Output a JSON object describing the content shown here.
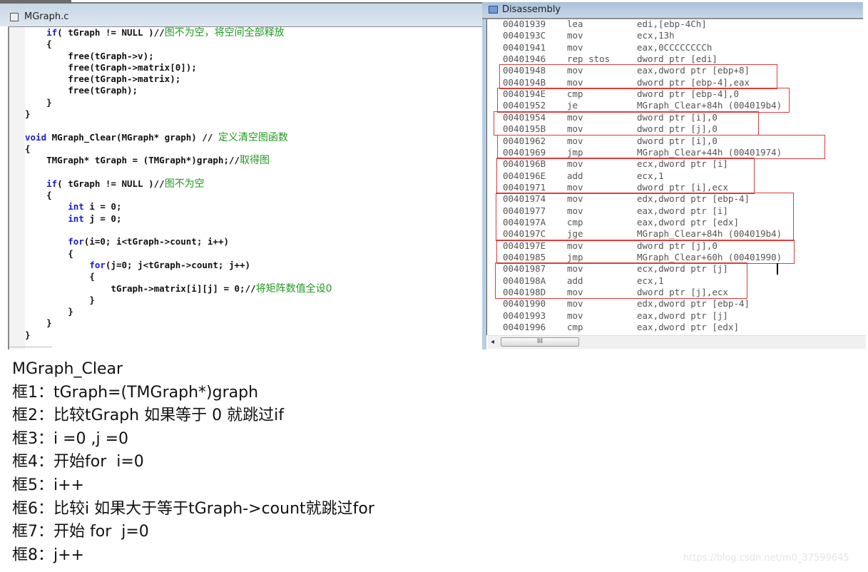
{
  "code_window": {
    "title": "MGraph.c",
    "lines": [
      {
        "indent": "    ",
        "kw": "if",
        "code": "( tGraph != NULL )//",
        "comment": "图不为空，将空间全部释放"
      },
      {
        "indent": "    ",
        "kw": "",
        "code": "{",
        "comment": ""
      },
      {
        "indent": "        ",
        "kw": "",
        "code": "free(tGraph->v);",
        "comment": ""
      },
      {
        "indent": "        ",
        "kw": "",
        "code": "free(tGraph->matrix[0]);",
        "comment": ""
      },
      {
        "indent": "        ",
        "kw": "",
        "code": "free(tGraph->matrix);",
        "comment": ""
      },
      {
        "indent": "        ",
        "kw": "",
        "code": "free(tGraph);",
        "comment": ""
      },
      {
        "indent": "    ",
        "kw": "",
        "code": "}",
        "comment": ""
      },
      {
        "indent": "",
        "kw": "",
        "code": "}",
        "comment": ""
      },
      {
        "indent": "",
        "kw": "",
        "code": "",
        "comment": ""
      },
      {
        "indent": "",
        "kw": "void",
        "code": " MGraph_Clear(MGraph* graph) // ",
        "comment": "定义清空图函数"
      },
      {
        "indent": "",
        "kw": "",
        "code": "{",
        "comment": ""
      },
      {
        "indent": "    ",
        "kw": "",
        "code": "TMGraph* tGraph = (TMGraph*)graph;//",
        "comment": "取得图"
      },
      {
        "indent": "",
        "kw": "",
        "code": "",
        "comment": ""
      },
      {
        "indent": "    ",
        "kw": "if",
        "code": "( tGraph != NULL )//",
        "comment": "图不为空"
      },
      {
        "indent": "    ",
        "kw": "",
        "code": "{",
        "comment": ""
      },
      {
        "indent": "        ",
        "kw": "int",
        "code": " i = 0;",
        "comment": ""
      },
      {
        "indent": "        ",
        "kw": "int",
        "code": " j = 0;",
        "comment": ""
      },
      {
        "indent": "",
        "kw": "",
        "code": "",
        "comment": ""
      },
      {
        "indent": "        ",
        "kw": "for",
        "code": "(i=0; i<tGraph->count; i++)",
        "comment": ""
      },
      {
        "indent": "        ",
        "kw": "",
        "code": "{",
        "comment": ""
      },
      {
        "indent": "            ",
        "kw": "for",
        "code": "(j=0; j<tGraph->count; j++)",
        "comment": ""
      },
      {
        "indent": "            ",
        "kw": "",
        "code": "{",
        "comment": ""
      },
      {
        "indent": "                ",
        "kw": "",
        "code": "tGraph->matrix[i][j] = 0;//",
        "comment": "将矩阵数值全设0"
      },
      {
        "indent": "            ",
        "kw": "",
        "code": "}",
        "comment": ""
      },
      {
        "indent": "        ",
        "kw": "",
        "code": "}",
        "comment": ""
      },
      {
        "indent": "    ",
        "kw": "",
        "code": "}",
        "comment": ""
      },
      {
        "indent": "",
        "kw": "",
        "code": "}",
        "comment": ""
      }
    ]
  },
  "disassembly_window": {
    "title": "Disassembly",
    "rows": [
      {
        "addr": "00401939",
        "op": "lea",
        "arg": "edi,[ebp-4Ch]"
      },
      {
        "addr": "0040193C",
        "op": "mov",
        "arg": "ecx,13h"
      },
      {
        "addr": "00401941",
        "op": "mov",
        "arg": "eax,0CCCCCCCCh"
      },
      {
        "addr": "00401946",
        "op": "rep stos",
        "arg": "dword ptr [edi]"
      },
      {
        "addr": "00401948",
        "op": "mov",
        "arg": "eax,dword ptr [ebp+8]"
      },
      {
        "addr": "0040194B",
        "op": "mov",
        "arg": "dword ptr [ebp-4],eax"
      },
      {
        "addr": "0040194E",
        "op": "cmp",
        "arg": "dword ptr [ebp-4],0"
      },
      {
        "addr": "00401952",
        "op": "je",
        "arg": "MGraph_Clear+84h (004019b4)"
      },
      {
        "addr": "00401954",
        "op": "mov",
        "arg": "dword ptr [i],0"
      },
      {
        "addr": "0040195B",
        "op": "mov",
        "arg": "dword ptr [j],0"
      },
      {
        "addr": "00401962",
        "op": "mov",
        "arg": "dword ptr [i],0"
      },
      {
        "addr": "00401969",
        "op": "jmp",
        "arg": "MGraph_Clear+44h (00401974)"
      },
      {
        "addr": "0040196B",
        "op": "mov",
        "arg": "ecx,dword ptr [i]"
      },
      {
        "addr": "0040196E",
        "op": "add",
        "arg": "ecx,1"
      },
      {
        "addr": "00401971",
        "op": "mov",
        "arg": "dword ptr [i],ecx"
      },
      {
        "addr": "00401974",
        "op": "mov",
        "arg": "edx,dword ptr [ebp-4]"
      },
      {
        "addr": "00401977",
        "op": "mov",
        "arg": "eax,dword ptr [i]"
      },
      {
        "addr": "0040197A",
        "op": "cmp",
        "arg": "eax,dword ptr [edx]"
      },
      {
        "addr": "0040197C",
        "op": "jge",
        "arg": "MGraph_Clear+84h (004019b4)"
      },
      {
        "addr": "0040197E",
        "op": "mov",
        "arg": "dword ptr [j],0"
      },
      {
        "addr": "00401985",
        "op": "jmp",
        "arg": "MGraph_Clear+60h (00401990)"
      },
      {
        "addr": "00401987",
        "op": "mov",
        "arg": "ecx,dword ptr [j]"
      },
      {
        "addr": "0040198A",
        "op": "add",
        "arg": "ecx,1"
      },
      {
        "addr": "0040198D",
        "op": "mov",
        "arg": "dword ptr [j],ecx"
      },
      {
        "addr": "00401990",
        "op": "mov",
        "arg": "edx,dword ptr [ebp-4]"
      },
      {
        "addr": "00401993",
        "op": "mov",
        "arg": "eax,dword ptr [j]"
      },
      {
        "addr": "00401996",
        "op": "cmp",
        "arg": "eax,dword ptr [edx]"
      }
    ],
    "highlight_boxes": [
      {
        "label": "框1",
        "first_row": 4,
        "last_row": 5
      },
      {
        "label": "框2",
        "first_row": 6,
        "last_row": 7
      },
      {
        "label": "框3",
        "first_row": 8,
        "last_row": 9
      },
      {
        "label": "框4",
        "first_row": 10,
        "last_row": 11
      },
      {
        "label": "框5",
        "first_row": 12,
        "last_row": 14
      },
      {
        "label": "框6",
        "first_row": 15,
        "last_row": 18
      },
      {
        "label": "框7",
        "first_row": 19,
        "last_row": 20
      },
      {
        "label": "框8",
        "first_row": 21,
        "last_row": 23
      }
    ],
    "highlight_color": "#e03b3b",
    "scrollbar_thumb_label": "III"
  },
  "notes": {
    "title": "MGraph_Clear",
    "items": [
      "框1：tGraph=(TMGraph*)graph",
      "框2：比较tGraph 如果等于 0 就跳过if",
      "框3：i =0 ,j =0",
      "框4：开始for  i=0",
      "框5：i++",
      "框6：比较i 如果大于等于tGraph->count就跳过for",
      "框7：开始 for  j=0",
      "框8：j++"
    ]
  },
  "watermark": "https://blog.csdn.net/m0_37599645"
}
